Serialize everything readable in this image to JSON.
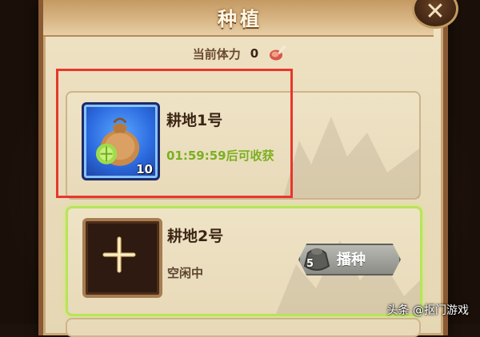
{
  "header": {
    "title": "种植"
  },
  "stamina": {
    "label": "当前体力",
    "value": "0",
    "icon": "meat-icon"
  },
  "plots": [
    {
      "name": "耕地1号",
      "item_icon": "seed-bag-icon",
      "item_count": "10",
      "timer": "01:59:59后可收获"
    },
    {
      "name": "耕地2号",
      "item_icon": "empty-plot-icon",
      "status": "空闲中",
      "sow_button": {
        "label": "播种",
        "seed_count": "5"
      }
    }
  ],
  "watermark": "头条 @抠门游戏",
  "colors": {
    "highlight": "#e8372c",
    "timer": "#7bb01f",
    "active_border": "#b7e45a"
  }
}
